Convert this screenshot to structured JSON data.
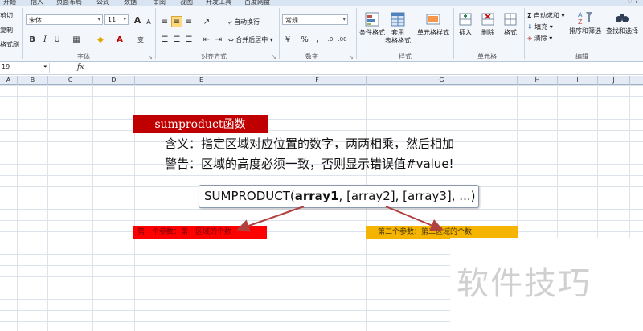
{
  "ribbon_tabs": [
    "开始",
    "插入",
    "页面布局",
    "公式",
    "数据",
    "审阅",
    "视图",
    "开发工具",
    "百度网盘"
  ],
  "clipboard": {
    "cut": "剪切",
    "copy": "复制",
    "format_painter": "格式刷"
  },
  "font": {
    "name": "宋体",
    "size": "11",
    "bold": "B",
    "italic": "I",
    "underline": "U",
    "grow": "A",
    "shrink": "A",
    "group_label": "字体",
    "wen": "变"
  },
  "alignment": {
    "wrap": "自动换行",
    "merge": "合并后居中",
    "group_label": "对齐方式"
  },
  "number": {
    "format": "常规",
    "percent": "%",
    "comma": ",",
    "group_label": "数字"
  },
  "styles": {
    "conditional": "条件格式",
    "table": "套用\n表格格式",
    "cell": "单元格样式",
    "group_label": "样式"
  },
  "cells": {
    "insert": "插入",
    "delete": "删除",
    "format": "格式",
    "group_label": "单元格"
  },
  "editing": {
    "autosum": "自动求和",
    "fill": "填充",
    "clear": "清除",
    "sort": "排序和筛选",
    "find": "查找和选择",
    "group_label": "编辑"
  },
  "formula_bar": {
    "name_box": "19",
    "fx": "fx"
  },
  "columns": [
    "A",
    "B",
    "C",
    "D",
    "E",
    "F",
    "G",
    "H",
    "I",
    "J"
  ],
  "content": {
    "title": "sumproduct函数",
    "meaning": "含义：指定区域对应位置的数字，两两相乘，然后相加",
    "warning": "警告：区域的高度必须一致，否则显示错误值#value!",
    "tooltip_fn": "SUMPRODUCT(",
    "tooltip_arg1": "array1",
    "tooltip_rest": ", [array2], [array3], ...)",
    "label_first": "第一个参数：第一区域的个数",
    "label_second": "第二个参数：第二区域的个数",
    "watermark": "软件技巧"
  },
  "colors": {
    "title_bg": "#c00000",
    "label_red": "#ff0000",
    "label_yellow": "#f4b400",
    "arrow": "#b0413e"
  }
}
